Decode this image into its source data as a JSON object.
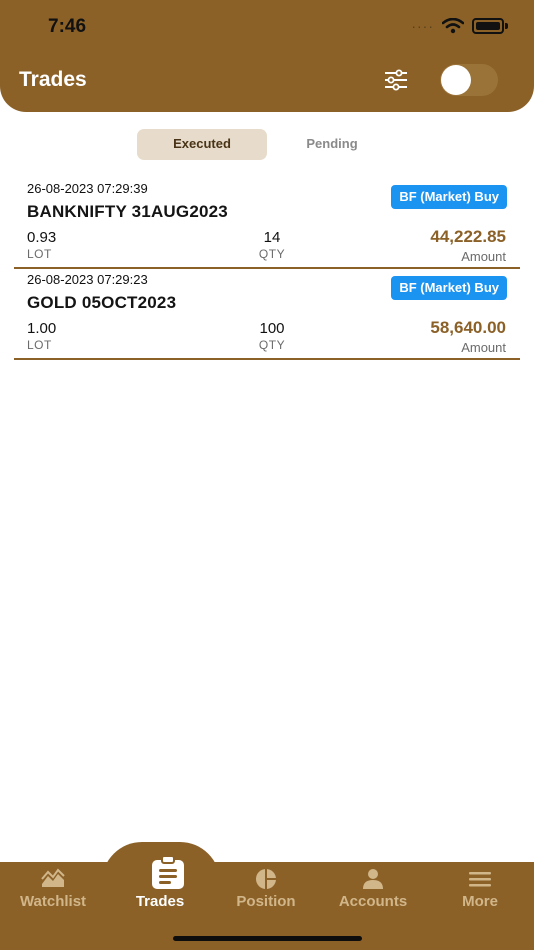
{
  "status_bar": {
    "time": "7:46"
  },
  "header": {
    "title": "Trades"
  },
  "tabs": [
    {
      "label": "Executed",
      "active": true
    },
    {
      "label": "Pending",
      "active": false
    }
  ],
  "trades": [
    {
      "datetime": "26-08-2023 07:29:39",
      "symbol": "BANKNIFTY 31AUG2023",
      "type": "BF (Market) Buy",
      "lot": "0.93",
      "lot_label": "LOT",
      "qty": "14",
      "qty_label": "QTY",
      "amount": "44,222.85",
      "amount_label": "Amount"
    },
    {
      "datetime": "26-08-2023 07:29:23",
      "symbol": "GOLD 05OCT2023",
      "type": "BF (Market) Buy",
      "lot": "1.00",
      "lot_label": "LOT",
      "qty": "100",
      "qty_label": "QTY",
      "amount": "58,640.00",
      "amount_label": "Amount"
    }
  ],
  "bottom_nav": [
    {
      "label": "Watchlist",
      "icon": "watchlist-icon",
      "active": false
    },
    {
      "label": "Trades",
      "icon": "trades-clipboard-icon",
      "active": true
    },
    {
      "label": "Position",
      "icon": "pie-chart-icon",
      "active": false
    },
    {
      "label": "Accounts",
      "icon": "person-icon",
      "active": false
    },
    {
      "label": "More",
      "icon": "hamburger-menu-icon",
      "active": false
    }
  ],
  "colors": {
    "brand": "#8b6128",
    "badge": "#1b93f0",
    "tab_active_bg": "#e7dccb",
    "nav_inactive": "#d1b68a"
  }
}
